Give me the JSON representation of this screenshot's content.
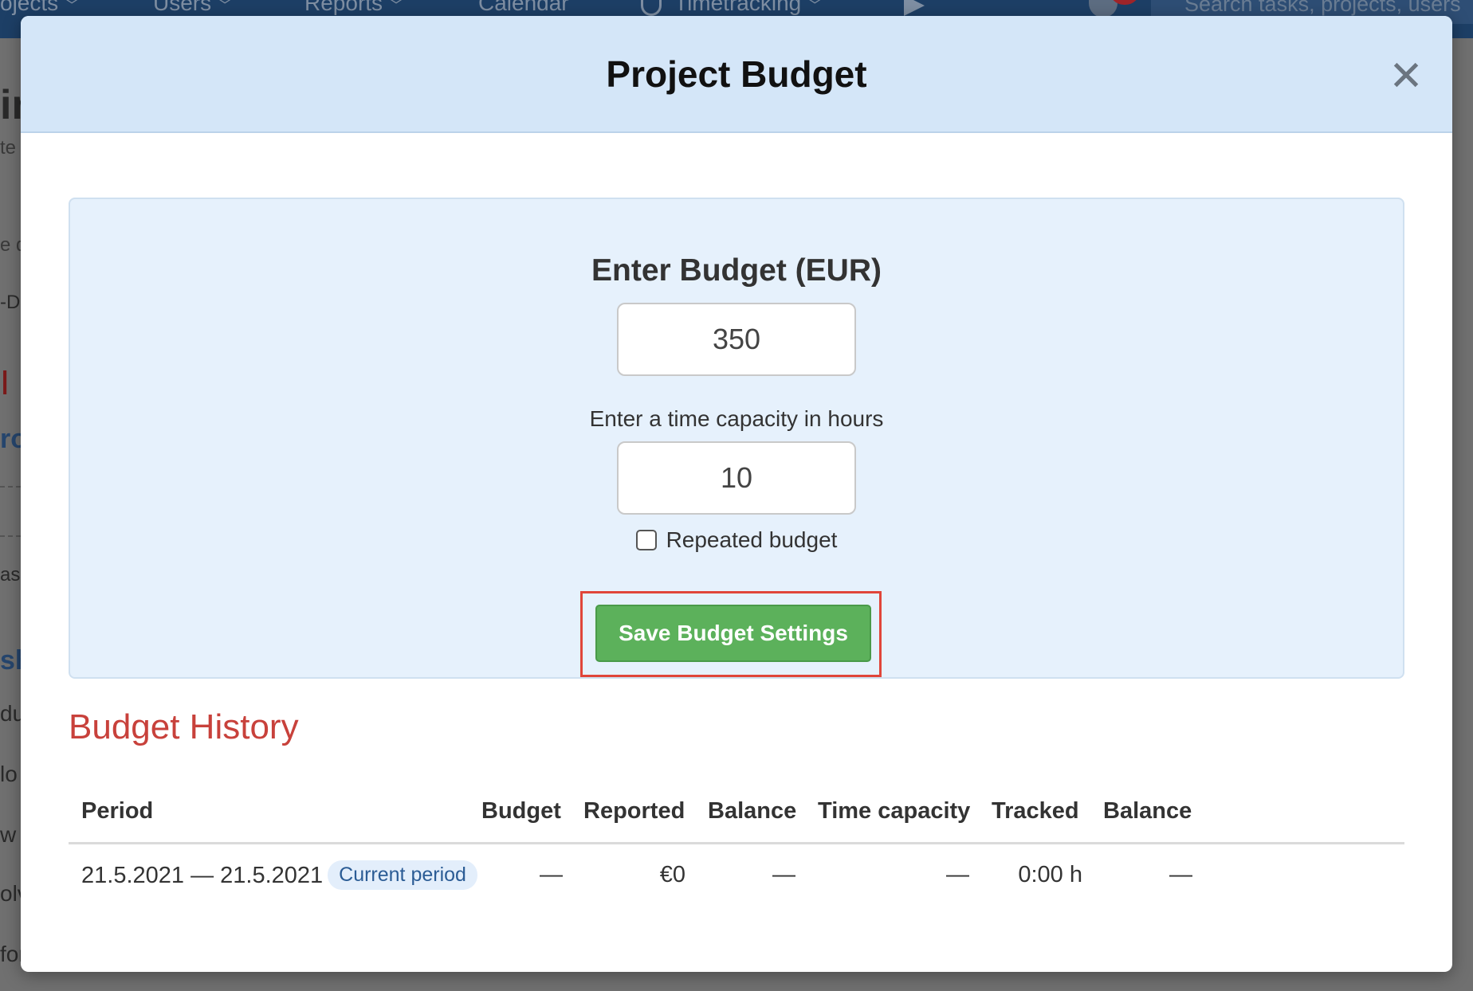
{
  "background": {
    "nav": {
      "items": [
        {
          "label": "ojects"
        },
        {
          "label": "Users"
        },
        {
          "label": "Reports"
        },
        {
          "label": "Calendar"
        },
        {
          "label": "Timetracking"
        }
      ],
      "search_placeholder": "Search tasks, projects, users"
    },
    "fragments": [
      "in",
      "te",
      "e d",
      "-D",
      "I",
      "ro",
      "asl",
      "she",
      "du",
      "lo",
      "w t",
      "olv",
      "for"
    ]
  },
  "modal": {
    "title": "Project Budget",
    "close_glyph": "✕"
  },
  "budget_form": {
    "heading": "Enter Budget (EUR)",
    "budget_value": "350",
    "capacity_label": "Enter a time capacity in hours",
    "capacity_value": "10",
    "repeated_label": "Repeated budget",
    "repeated_checked": false,
    "save_label": "Save Budget Settings"
  },
  "history": {
    "title": "Budget History",
    "columns": [
      "Period",
      "Budget",
      "Reported",
      "Balance",
      "Time capacity",
      "Tracked",
      "Balance"
    ],
    "rows": [
      {
        "period": "21.5.2021 — 21.5.2021",
        "badge": "Current period",
        "budget": "—",
        "reported": "€0",
        "balance": "—",
        "time_capacity": "—",
        "tracked": "0:00 h",
        "time_balance": "—"
      }
    ]
  },
  "colors": {
    "header_bg": "#d4e6f8",
    "panel_bg": "#e6f1fc",
    "save_button": "#5cb15b",
    "highlight_border": "#e0453a",
    "history_title": "#c8413b",
    "badge_bg": "#e3eefb",
    "nav_bg": "#1d3f66"
  }
}
